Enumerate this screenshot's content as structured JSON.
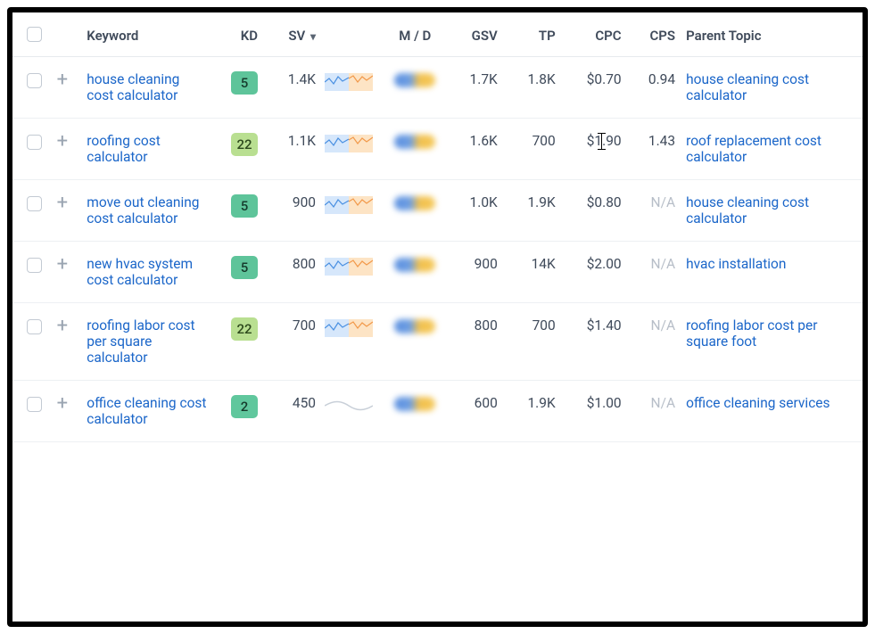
{
  "headers": {
    "keyword": "Keyword",
    "kd": "KD",
    "sv": "SV",
    "md": "M / D",
    "gsv": "GSV",
    "tp": "TP",
    "cpc": "CPC",
    "cps": "CPS",
    "parent_topic": "Parent Topic"
  },
  "rows": [
    {
      "keyword": "house cleaning cost calculator",
      "kd": "5",
      "kd_class": "kd-low",
      "sv": "1.4K",
      "gsv": "1.7K",
      "tp": "1.8K",
      "cpc": "$0.70",
      "cps": "0.94",
      "cps_na": false,
      "parent_topic": "house cleaning cost calculator",
      "trend": "color"
    },
    {
      "keyword": "roofing cost calculator",
      "kd": "22",
      "kd_class": "kd-mid",
      "sv": "1.1K",
      "gsv": "1.6K",
      "tp": "700",
      "cpc": "$1.90",
      "cps": "1.43",
      "cps_na": false,
      "parent_topic": "roof replacement cost calculator",
      "trend": "color",
      "cpc_cursor": true
    },
    {
      "keyword": "move out cleaning cost calculator",
      "kd": "5",
      "kd_class": "kd-low",
      "sv": "900",
      "gsv": "1.0K",
      "tp": "1.9K",
      "cpc": "$0.80",
      "cps": "N/A",
      "cps_na": true,
      "parent_topic": "house cleaning cost calculator",
      "trend": "color"
    },
    {
      "keyword": "new hvac system cost calculator",
      "kd": "5",
      "kd_class": "kd-low",
      "sv": "800",
      "gsv": "900",
      "tp": "14K",
      "cpc": "$2.00",
      "cps": "N/A",
      "cps_na": true,
      "parent_topic": "hvac installation",
      "trend": "color"
    },
    {
      "keyword": "roofing labor cost per square calculator",
      "kd": "22",
      "kd_class": "kd-mid",
      "sv": "700",
      "gsv": "800",
      "tp": "700",
      "cpc": "$1.40",
      "cps": "N/A",
      "cps_na": true,
      "parent_topic": "roofing labor cost per square foot",
      "trend": "color"
    },
    {
      "keyword": "office cleaning cost calculator",
      "kd": "2",
      "kd_class": "kd-vlow",
      "sv": "450",
      "gsv": "600",
      "tp": "1.9K",
      "cpc": "$1.00",
      "cps": "N/A",
      "cps_na": true,
      "parent_topic": "office cleaning services",
      "trend": "gray"
    }
  ]
}
